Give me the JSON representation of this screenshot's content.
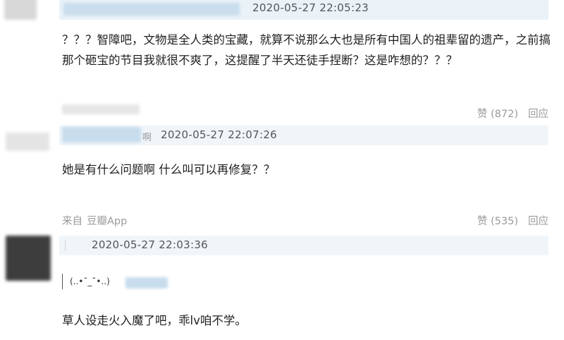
{
  "comments": [
    {
      "timestamp": "2020-05-27 22:05:23",
      "text": "？？？智障吧，文物是全人类的宝藏，就算不说那么大也是所有中国人的祖辈留的遗产，之前搞那个砸宝的节目我就很不爽了，这提醒了半天还徒手捏断？这是咋想的？？？",
      "like_label": "赞 (872)",
      "reply_label": "回应"
    },
    {
      "name_tail": "啊",
      "timestamp": "2020-05-27 22:07:26",
      "text": "她是有什么问题啊 什么叫可以再修复？？",
      "source_prefix": "来自",
      "source_app": "豆瓣App",
      "like_label": "赞 (535)",
      "reply_label": "回应"
    },
    {
      "timestamp": "2020-05-27 22:03:36",
      "emoticon": "(..•˘_˘•..)",
      "text": "草人设走火入魔了吧，乖lv咱不学。"
    }
  ],
  "colors": {
    "meta_bg": "#eaf2f8",
    "muted_text": "#9a9a9a",
    "body_text": "#1f1f1f"
  }
}
